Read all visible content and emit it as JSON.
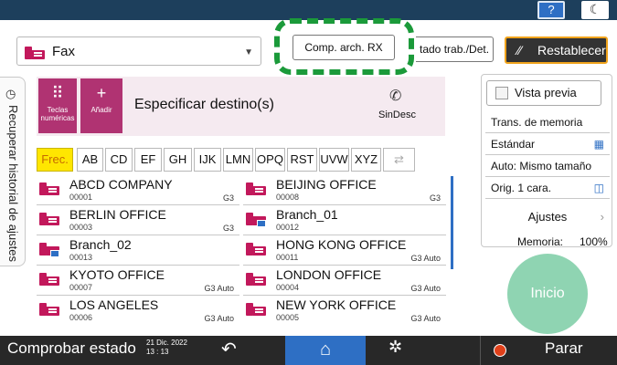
{
  "topbar": {
    "help_label": "?",
    "moon_icon": "moon-icon"
  },
  "function_select": {
    "value": "Fax",
    "icon": "fax-icon",
    "arrow_icon": "triangle-down-icon"
  },
  "buttons": {
    "comp_arch": "Comp. arch. RX",
    "estado": "tado trab./Det.",
    "restablecer": "Restablecer"
  },
  "history_tab": {
    "label": "Recuperar historial de ajustes"
  },
  "destination": {
    "keypad_label": "Teclas numéricas",
    "add_label": "Añadir",
    "title": "Especificar destino(s)",
    "sindesc": "SinDesc"
  },
  "tabs": [
    {
      "label": "Frec."
    },
    {
      "label": "AB"
    },
    {
      "label": "CD"
    },
    {
      "label": "EF"
    },
    {
      "label": "GH"
    },
    {
      "label": "IJK"
    },
    {
      "label": "LMN"
    },
    {
      "label": "OPQ"
    },
    {
      "label": "RST"
    },
    {
      "label": "UVW"
    },
    {
      "label": "XYZ"
    },
    {
      "label": "⇄"
    }
  ],
  "entries": [
    {
      "name": "ABCD COMPANY",
      "num": "00001",
      "mode": "G3",
      "group": false
    },
    {
      "name": "BEIJING OFFICE",
      "num": "00008",
      "mode": "G3",
      "group": false
    },
    {
      "name": "BERLIN OFFICE",
      "num": "00003",
      "mode": "G3",
      "group": false
    },
    {
      "name": "Branch_01",
      "num": "00012",
      "mode": "",
      "group": true
    },
    {
      "name": "Branch_02",
      "num": "00013",
      "mode": "",
      "group": true
    },
    {
      "name": "HONG KONG OFFICE",
      "num": "00011",
      "mode": "G3 Auto",
      "group": false
    },
    {
      "name": "KYOTO OFFICE",
      "num": "00007",
      "mode": "G3 Auto",
      "group": false
    },
    {
      "name": "LONDON OFFICE",
      "num": "00004",
      "mode": "G3 Auto",
      "group": false
    },
    {
      "name": "LOS ANGELES",
      "num": "00006",
      "mode": "G3 Auto",
      "group": false
    },
    {
      "name": "NEW YORK OFFICE",
      "num": "00005",
      "mode": "G3 Auto",
      "group": false
    }
  ],
  "settings": {
    "preview": "Vista previa",
    "rows": [
      {
        "label": "Trans. de memoria"
      },
      {
        "label": "Estándar"
      },
      {
        "label": "Auto: Mismo tamaño"
      },
      {
        "label": "Orig. 1 cara."
      }
    ],
    "ajustes": "Ajustes",
    "memoria_label": "Memoria:",
    "memoria_value": "100%",
    "start": "Inicio"
  },
  "bottombar": {
    "status": "Comprobar estado",
    "date": "21 Dic. 2022",
    "time": "13 : 13",
    "stop": "Parar"
  },
  "colors": {
    "accent_magenta": "#b03372",
    "active_tab": "#ffe600",
    "highlight_green": "#1b9a3a",
    "home_blue": "#2e6fc4",
    "start_green": "#8fd4b2"
  }
}
